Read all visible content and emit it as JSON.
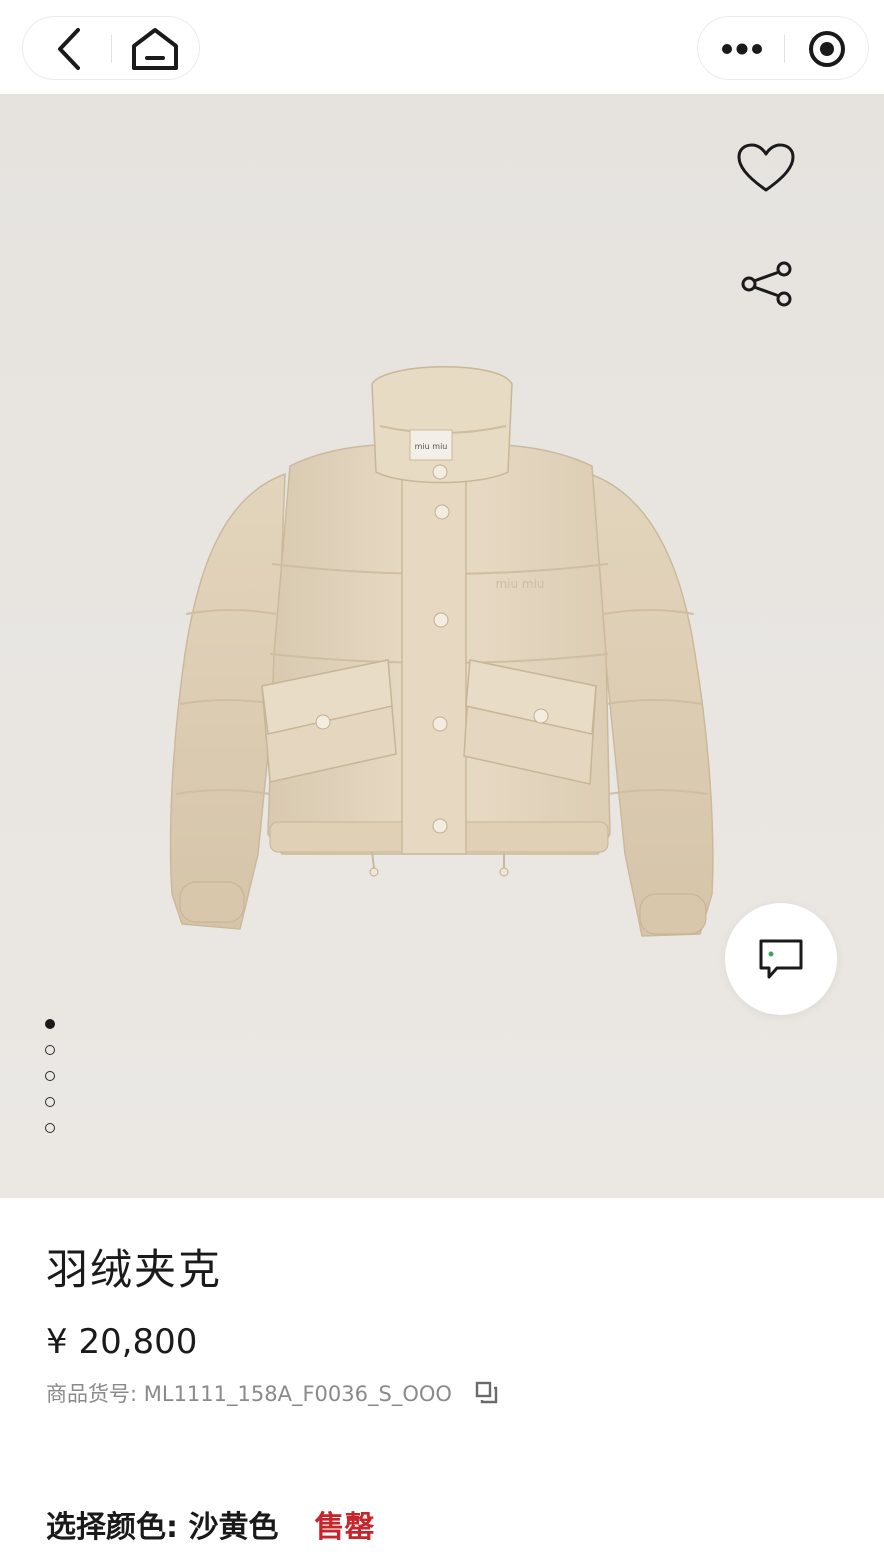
{
  "topbar": {
    "back_icon": "chevron-left-icon",
    "home_icon": "home-icon",
    "more_icon": "more-dots-icon",
    "close_icon": "target-circle-icon"
  },
  "gallery": {
    "image_description_icon": "down-jacket-photo",
    "favorite_icon": "heart-icon",
    "share_icon": "share-icon",
    "chat_icon": "chat-bubble-icon",
    "dots": [
      true,
      false,
      false,
      false,
      false
    ],
    "jacket_tag": "miu miu",
    "jacket_chest_text": "miu miu"
  },
  "product": {
    "name": "羽绒夹克",
    "price": "¥ 20,800",
    "sku_label": "商品货号: ML1111_158A_F0036_S_OOO",
    "copy_icon": "copy-icon",
    "color_label": "选择颜色: 沙黄色",
    "status": "售罄"
  },
  "colors": {
    "accent_red": "#c8242b",
    "jacket_beige": "#e4d6bf",
    "background": "#e8e5e1"
  }
}
